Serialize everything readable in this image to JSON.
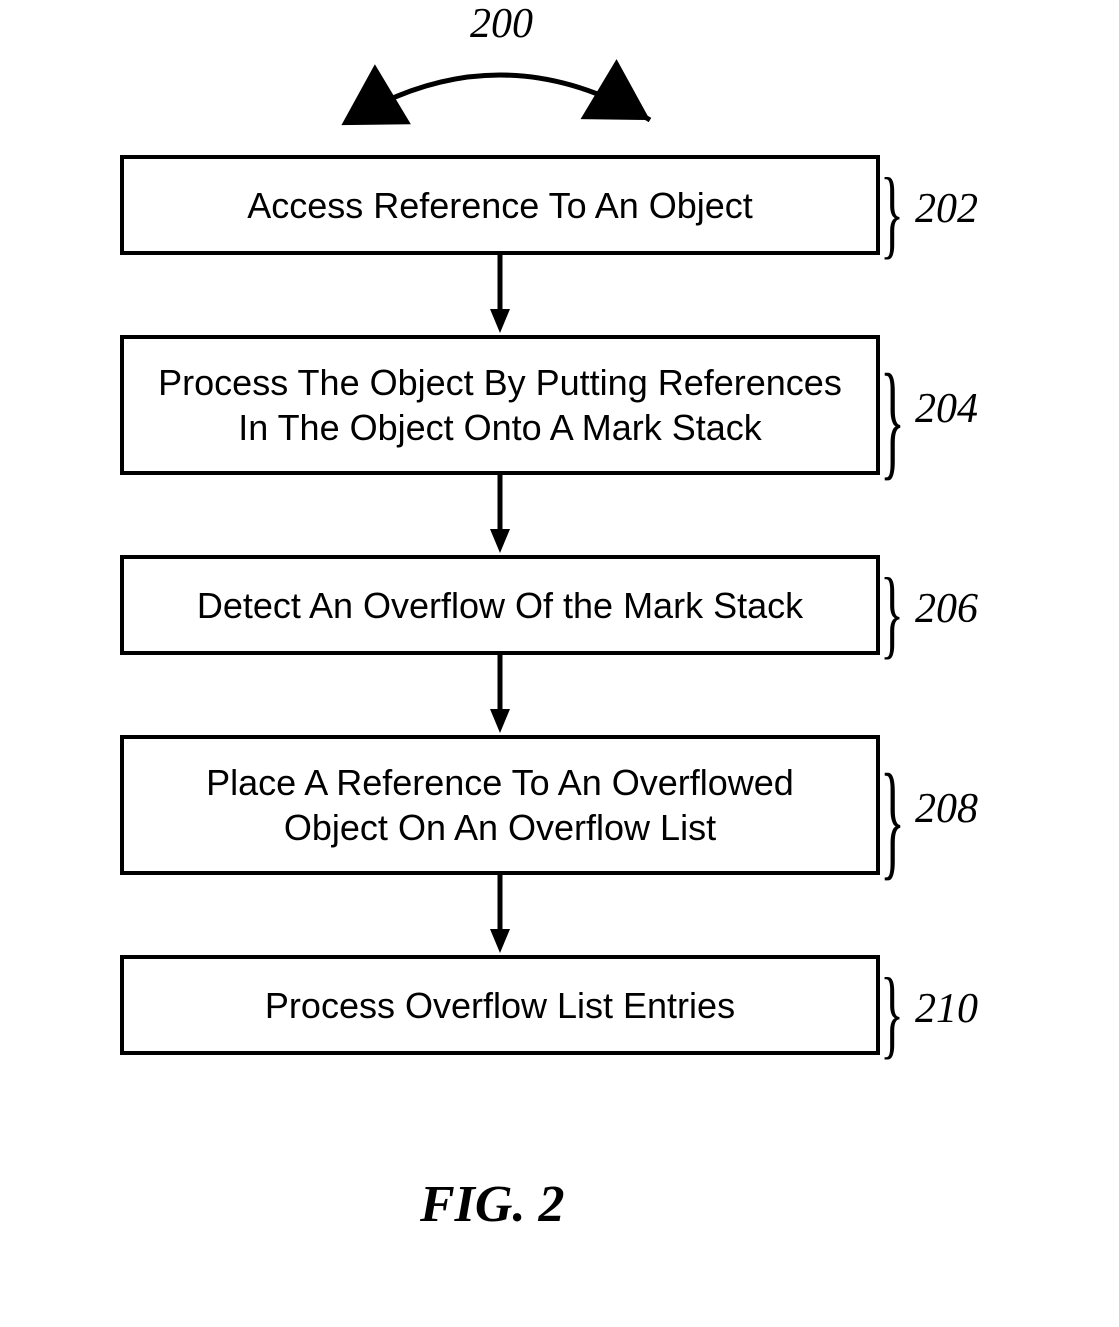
{
  "chart_data": {
    "type": "flowchart",
    "title": "FIG. 2",
    "top_label": "200",
    "nodes": [
      {
        "id": "202",
        "label": "Access Reference To An Object",
        "ref": "202"
      },
      {
        "id": "204",
        "label": "Process The Object By Putting References In The Object Onto A Mark Stack",
        "ref": "204"
      },
      {
        "id": "206",
        "label": "Detect An Overflow Of the Mark Stack",
        "ref": "206"
      },
      {
        "id": "208",
        "label": "Place A Reference To An Overflowed Object On An Overflow List",
        "ref": "208"
      },
      {
        "id": "210",
        "label": "Process Overflow List Entries",
        "ref": "210"
      }
    ],
    "edges": [
      [
        "202",
        "204"
      ],
      [
        "204",
        "206"
      ],
      [
        "206",
        "208"
      ],
      [
        "208",
        "210"
      ]
    ]
  },
  "diagram": {
    "top_label": "200",
    "figure_caption": "FIG. 2",
    "boxes": {
      "b1": {
        "text": "Access Reference To An Object",
        "ref": "202"
      },
      "b2": {
        "text": "Process The Object By Putting References\nIn The Object Onto A Mark Stack",
        "ref": "204"
      },
      "b3": {
        "text": "Detect An Overflow Of the Mark Stack",
        "ref": "206"
      },
      "b4": {
        "text": "Place A Reference To An Overflowed\nObject On An Overflow List",
        "ref": "208"
      },
      "b5": {
        "text": "Process Overflow List Entries",
        "ref": "210"
      }
    }
  }
}
